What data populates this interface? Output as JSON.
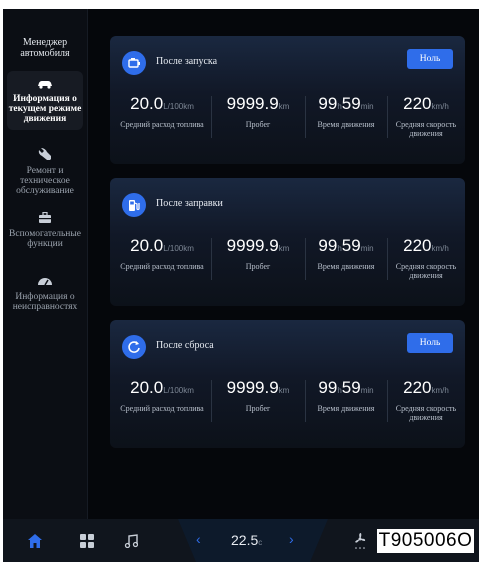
{
  "sidebar": {
    "title": "Менеджер автомобиля",
    "items": [
      {
        "label": "Информация о текущем режиме движения",
        "icon": "car-icon",
        "active": true
      },
      {
        "label": "Ремонт и техническое обслуживание",
        "icon": "wrench-icon",
        "active": false
      },
      {
        "label": "Вспомогательные функции",
        "icon": "toolbox-icon",
        "active": false
      },
      {
        "label": "Информация о неисправностях",
        "icon": "gauge-icon",
        "active": false
      }
    ]
  },
  "cards": [
    {
      "title": "После запуска",
      "icon": "engine-icon",
      "reset_label": "Ноль",
      "stats": [
        {
          "value": "20.0",
          "unit": "L/100km",
          "label": "Средний расход топлива"
        },
        {
          "value": "9999.9",
          "unit": "km",
          "label": "Пробег"
        },
        {
          "value": "99",
          "unit": "h",
          "value2": "59",
          "unit2": "min",
          "label": "Время движения"
        },
        {
          "value": "220",
          "unit": "km/h",
          "label": "Средняя скорость движения"
        }
      ]
    },
    {
      "title": "После заправки",
      "icon": "fuel-pump-icon",
      "stats": [
        {
          "value": "20.0",
          "unit": "L/100km",
          "label": "Средний расход топлива"
        },
        {
          "value": "9999.9",
          "unit": "km",
          "label": "Пробег"
        },
        {
          "value": "99",
          "unit": "h",
          "value2": "59",
          "unit2": "min",
          "label": "Время движения"
        },
        {
          "value": "220",
          "unit": "km/h",
          "label": "Средняя скорость движения"
        }
      ]
    },
    {
      "title": "После сброса",
      "icon": "reset-icon",
      "reset_label": "Ноль",
      "stats": [
        {
          "value": "20.0",
          "unit": "L/100km",
          "label": "Средний расход топлива"
        },
        {
          "value": "9999.9",
          "unit": "km",
          "label": "Пробег"
        },
        {
          "value": "99",
          "unit": "h",
          "value2": "59",
          "unit2": "min",
          "label": "Время движения"
        },
        {
          "value": "220",
          "unit": "km/h",
          "label": "Средняя скорость движения"
        }
      ]
    }
  ],
  "bottom_bar": {
    "temperature": "22.5",
    "temperature_unit": "c",
    "icons": [
      "home-icon",
      "apps-grid-icon",
      "music-icon",
      "chevron-left-icon",
      "chevron-right-icon",
      "fan-icon"
    ]
  },
  "figure_code": "T905006O",
  "colors": {
    "accent": "#2f6dea",
    "background": "#05070b",
    "card": "#111827"
  }
}
